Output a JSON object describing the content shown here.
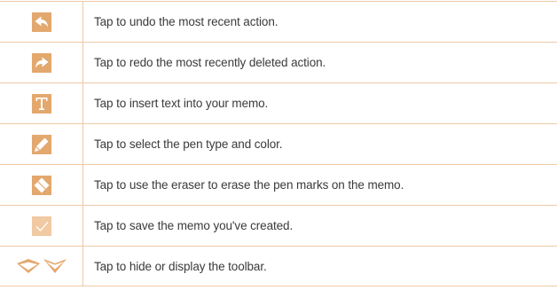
{
  "theme": {
    "border_color": "#efc9a6",
    "icon_tile_color": "#e3a86e",
    "text_color": "#3a3a3a"
  },
  "rows": [
    {
      "icon": "undo-icon",
      "text": "Tap to undo the most recent action."
    },
    {
      "icon": "redo-icon",
      "text": "Tap to redo the most recently deleted action."
    },
    {
      "icon": "text-icon",
      "text": "Tap to insert text into your memo."
    },
    {
      "icon": "pen-icon",
      "text": "Tap to select the pen type and color."
    },
    {
      "icon": "eraser-icon",
      "text": "Tap to use the eraser to erase the pen marks on the memo."
    },
    {
      "icon": "checkmark-icon",
      "text": "Tap to save the memo you've created."
    },
    {
      "icon": "toolbar-toggle-icon",
      "text": "Tap to hide or display the toolbar."
    }
  ]
}
